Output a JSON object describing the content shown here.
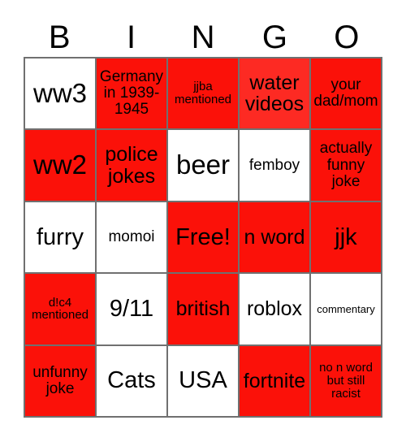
{
  "title": "BINGO card",
  "header": {
    "letters": [
      "B",
      "I",
      "N",
      "G",
      "O"
    ]
  },
  "colors": {
    "marked": "#fb1109",
    "marked_alt": "#fd2a23",
    "unmarked": "#ffffff",
    "border": "#707070",
    "text": "#000000"
  },
  "grid": {
    "rows": 5,
    "columns": 5,
    "cells": [
      {
        "label": "ww3",
        "marked": false,
        "size": "xxl"
      },
      {
        "label": "Germany in 1939-1945",
        "marked": true,
        "size": "m"
      },
      {
        "label": "jjba mentioned",
        "marked": true,
        "size": "s"
      },
      {
        "label": "water videos",
        "marked": true,
        "size": "l"
      },
      {
        "label": "your dad/mom",
        "marked": true,
        "size": "m"
      },
      {
        "label": "ww2",
        "marked": true,
        "size": "xxl"
      },
      {
        "label": "police jokes",
        "marked": true,
        "size": "l"
      },
      {
        "label": "beer",
        "marked": false,
        "size": "xxl"
      },
      {
        "label": "femboy",
        "marked": false,
        "size": "m"
      },
      {
        "label": "actually funny joke",
        "marked": true,
        "size": "m"
      },
      {
        "label": "furry",
        "marked": false,
        "size": "xl"
      },
      {
        "label": "momoi",
        "marked": false,
        "size": "m"
      },
      {
        "label": "Free!",
        "marked": true,
        "size": "xl"
      },
      {
        "label": "n word",
        "marked": true,
        "size": "l"
      },
      {
        "label": "jjk",
        "marked": true,
        "size": "xl"
      },
      {
        "label": "d!c4 mentioned",
        "marked": true,
        "size": "s"
      },
      {
        "label": "9/11",
        "marked": false,
        "size": "xl"
      },
      {
        "label": "british",
        "marked": true,
        "size": "l"
      },
      {
        "label": "roblox",
        "marked": false,
        "size": "l"
      },
      {
        "label": "commentary",
        "marked": false,
        "size": "xs"
      },
      {
        "label": "unfunny joke",
        "marked": true,
        "size": "m"
      },
      {
        "label": "Cats",
        "marked": false,
        "size": "xl"
      },
      {
        "label": "USA",
        "marked": false,
        "size": "xl"
      },
      {
        "label": "fortnite",
        "marked": true,
        "size": "l"
      },
      {
        "label": "no n word but still racist",
        "marked": true,
        "size": "s"
      }
    ]
  }
}
